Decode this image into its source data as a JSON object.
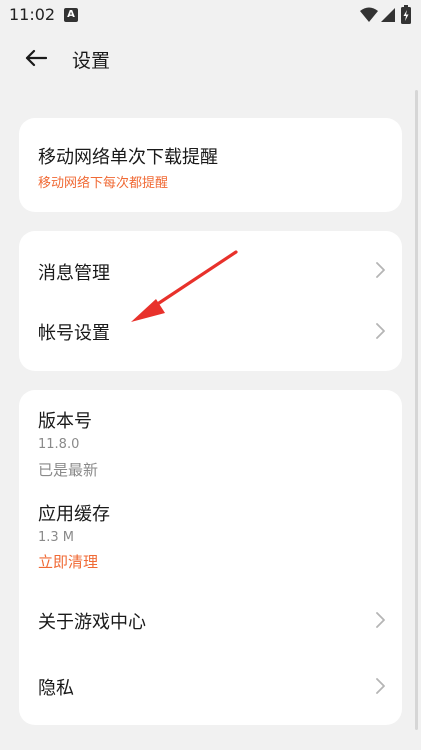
{
  "status_bar": {
    "time": "11:02",
    "notification_letter": "A"
  },
  "header": {
    "title": "设置"
  },
  "card_download": {
    "title": "移动网络单次下载提醒",
    "subtitle": "移动网络下每次都提醒"
  },
  "card_accounts": {
    "items": [
      {
        "label": "消息管理"
      },
      {
        "label": "帐号设置"
      }
    ]
  },
  "card_about": {
    "version": {
      "label": "版本号",
      "value": "11.8.0",
      "status": "已是最新"
    },
    "cache": {
      "label": "应用缓存",
      "size": "1.3 M",
      "action": "立即清理"
    },
    "items": [
      {
        "label": "关于游戏中心"
      },
      {
        "label": "隐私"
      }
    ]
  },
  "colors": {
    "accent": "#f06a35",
    "annotation_arrow": "#e8312b",
    "background": "#f1f1f1"
  }
}
